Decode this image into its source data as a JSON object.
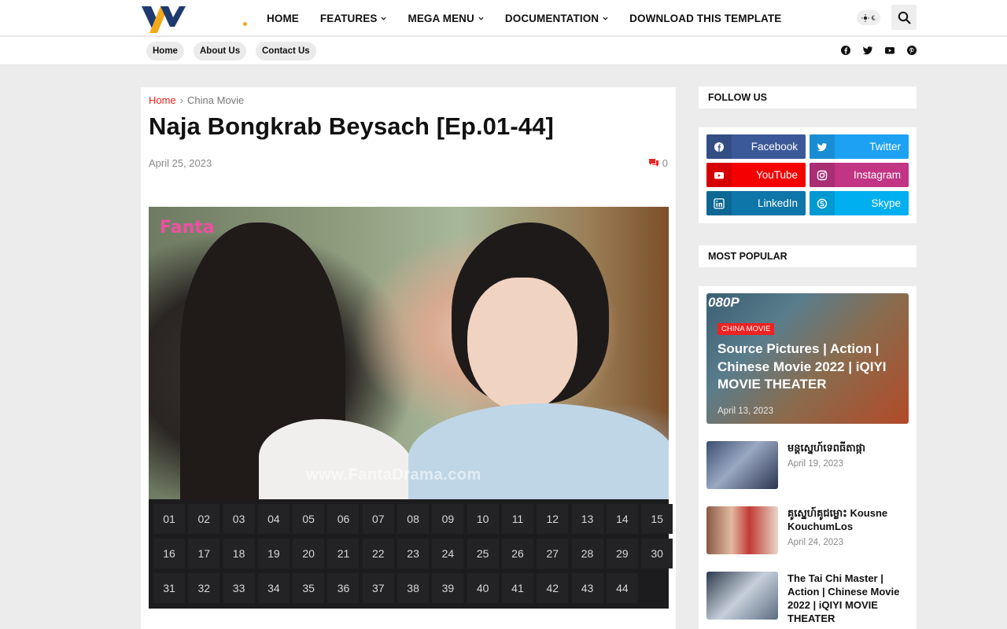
{
  "header": {
    "nav": [
      {
        "label": "HOME",
        "dropdown": false
      },
      {
        "label": "FEATURES",
        "dropdown": true
      },
      {
        "label": "MEGA MENU",
        "dropdown": true
      },
      {
        "label": "DOCUMENTATION",
        "dropdown": true
      },
      {
        "label": "DOWNLOAD THIS TEMPLATE",
        "dropdown": false
      }
    ],
    "accent_color": "#f4a81c"
  },
  "subnav": {
    "pills": [
      "Home",
      "About Us",
      "Contact Us"
    ],
    "social_icons": [
      "facebook-icon",
      "twitter-icon",
      "youtube-icon",
      "pinterest-icon"
    ]
  },
  "post": {
    "breadcrumb": {
      "home": "Home",
      "separator": "›",
      "category": "China Movie"
    },
    "title": "Naja Bongkrab Beysach [Ep.01-44]",
    "date": "April 25, 2023",
    "comment_count": "0",
    "video": {
      "brand": "Fanta",
      "watermark": "www.FantaDrama.com"
    },
    "episodes": [
      "01",
      "02",
      "03",
      "04",
      "05",
      "06",
      "07",
      "08",
      "09",
      "10",
      "11",
      "12",
      "13",
      "14",
      "15",
      "16",
      "17",
      "18",
      "19",
      "20",
      "21",
      "22",
      "23",
      "24",
      "25",
      "26",
      "27",
      "28",
      "29",
      "30",
      "31",
      "32",
      "33",
      "34",
      "35",
      "36",
      "37",
      "38",
      "39",
      "40",
      "41",
      "42",
      "43",
      "44"
    ]
  },
  "sidebar": {
    "follow_heading": "FOLLOW US",
    "social_buttons": [
      {
        "label": "Facebook",
        "color": "#3b5998",
        "icon": "facebook-icon"
      },
      {
        "label": "Twitter",
        "color": "#1da1f2",
        "icon": "twitter-icon"
      },
      {
        "label": "YouTube",
        "color": "#f50000",
        "icon": "youtube-icon"
      },
      {
        "label": "Instagram",
        "color": "#c13584",
        "icon": "instagram-icon"
      },
      {
        "label": "LinkedIn",
        "color": "#0e76a8",
        "icon": "linkedin-icon"
      },
      {
        "label": "Skype",
        "color": "#00aff0",
        "icon": "skype-icon"
      }
    ],
    "popular_heading": "MOST POPULAR",
    "featured": {
      "resolution": "080P",
      "tag": "CHINA MOVIE",
      "title": "Source Pictures | Action | Chinese Movie 2022 | iQIYI MOVIE THEATER",
      "date": "April 13, 2023"
    },
    "items": [
      {
        "title": "មន្តស្នេហ៍ទេពធីតាផ្កា",
        "date": "April 19, 2023"
      },
      {
        "title": "គូស្នេហ៍គូជម្លោះ Kousne KouchumLos",
        "date": "April 24, 2023"
      },
      {
        "title": "The Tai Chi Master | Action | Chinese Movie 2022 | iQIYI MOVIE THEATER",
        "date": ""
      }
    ]
  }
}
